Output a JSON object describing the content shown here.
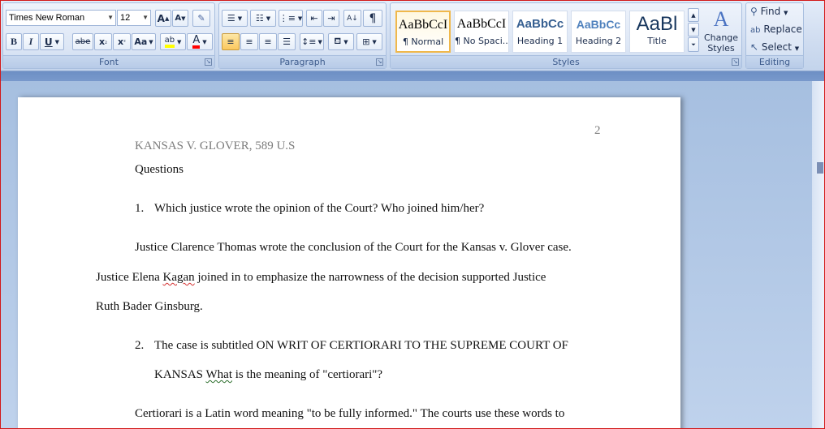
{
  "font": {
    "name": "Times New Roman",
    "size": "12",
    "group_label": "Font",
    "buttons": {
      "grow": "A",
      "shrink": "A",
      "bold": "B",
      "italic": "I",
      "underline": "U",
      "strike": "abe",
      "subscript": "x",
      "superscript": "x",
      "change_case": "Aa",
      "highlight": "ab",
      "color": "A"
    }
  },
  "paragraph": {
    "group_label": "Paragraph",
    "show_marks": "¶"
  },
  "styles": {
    "group_label": "Styles",
    "items": [
      {
        "sample": "AaBbCcI",
        "name": "¶ Normal"
      },
      {
        "sample": "AaBbCcI",
        "name": "¶ No Spaci..."
      },
      {
        "sample": "AaBbCc",
        "name": "Heading 1"
      },
      {
        "sample": "AaBbCc",
        "name": "Heading 2"
      },
      {
        "sample": "AaBl",
        "name": "Title"
      }
    ],
    "change_styles": "Change Styles"
  },
  "editing": {
    "group_label": "Editing",
    "find": "Find",
    "replace": "Replace",
    "select": "Select"
  },
  "colors": {
    "highlight": "#ffff00",
    "font_color": "#ff0000"
  },
  "document": {
    "page_number": "2",
    "header": "KANSAS V. GLOVER, 589 U.S",
    "questions_heading": "Questions",
    "q1_number": "1.",
    "q1_text": "Which justice wrote the opinion of the Court? Who joined him/her?",
    "a1_line1": "Justice Clarence Thomas wrote the conclusion of the Court for the Kansas v. Glover case.",
    "a1_line2_before": "Justice Elena ",
    "a1_line2_misspelled": "Kagan",
    "a1_line2_after": " joined in to emphasize the narrowness of the decision supported Justice",
    "a1_line3": "Ruth Bader Ginsburg.",
    "q2_number": "2.",
    "q2_line1": "The case is subtitled ON WRIT OF CERTIORARI TO THE SUPREME COURT OF",
    "q2_line2_before": "KANSAS ",
    "q2_line2_misspelled": "What",
    "q2_line2_after": " is the meaning of \"certiorari\"?",
    "a2_line1": "Certiorari is a Latin word meaning \"to be fully informed.\" The courts use these words to"
  }
}
